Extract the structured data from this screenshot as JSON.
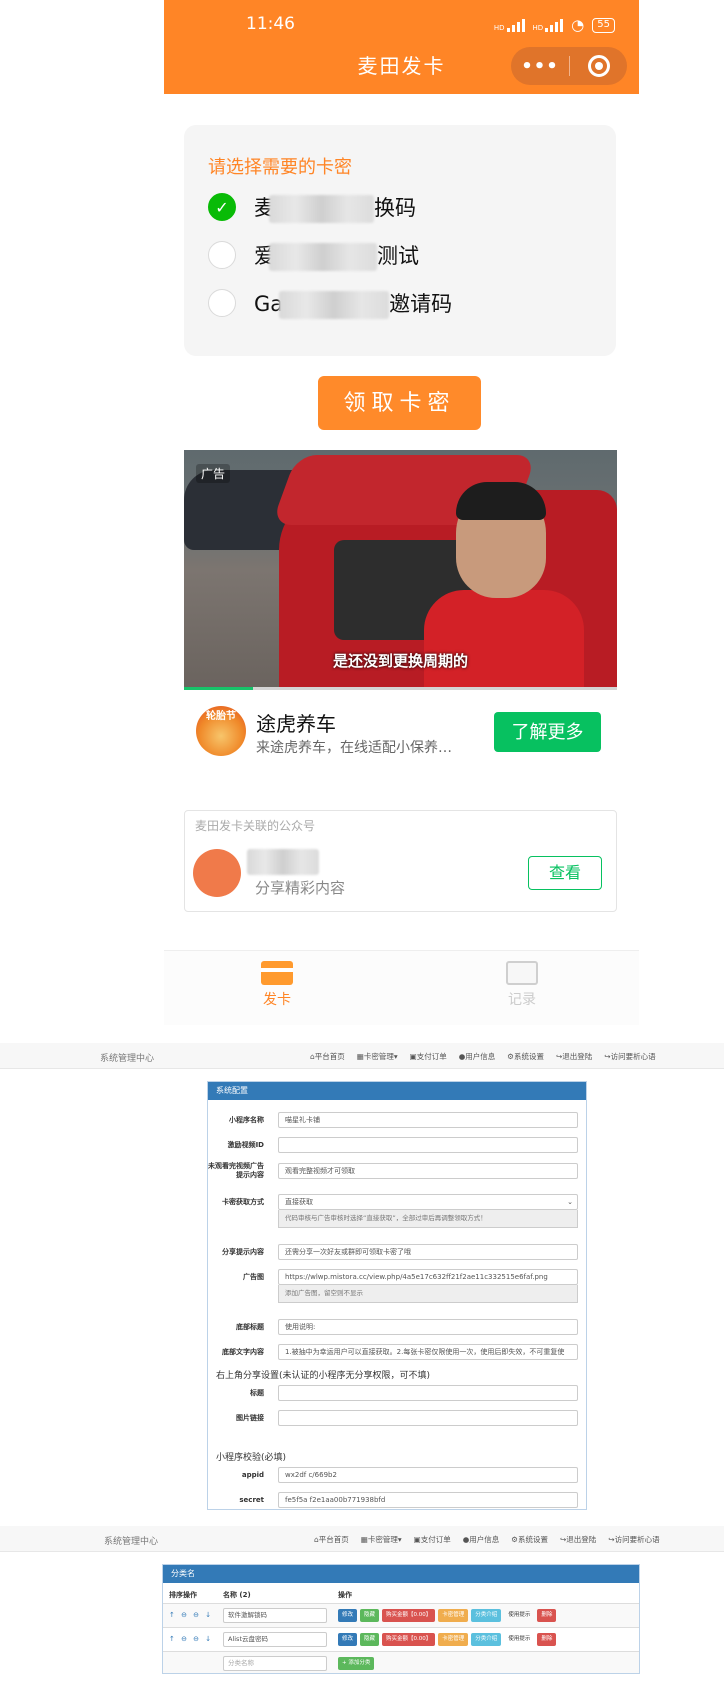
{
  "phone": {
    "status": {
      "time": "11:46",
      "battery": "55",
      "hd": "HD"
    },
    "app_title": "麦田发卡",
    "capsule": {
      "more": "•••"
    },
    "choose_title": "请选择需要的卡密",
    "options": [
      {
        "prefix": "麦",
        "suffix": "换码",
        "checked": true
      },
      {
        "prefix": "爱",
        "suffix": "测试",
        "checked": false
      },
      {
        "prefix": "Ga",
        "suffix": "邀请码",
        "checked": false
      }
    ],
    "get_button": "领取卡密",
    "ad": {
      "label": "广告",
      "subtitle": "是还没到更换周期的",
      "progress": 0.16,
      "logo_text": "轮胎节",
      "name": "途虎养车",
      "desc": "来途虎养车，在线适配小保养…",
      "more_button": "了解更多"
    },
    "official": {
      "title": "麦田发卡关联的公众号",
      "desc": "分享精彩内容",
      "view_button": "查看"
    },
    "tabs": [
      {
        "label": "发卡"
      },
      {
        "label": "记录"
      }
    ]
  },
  "admin_nav": {
    "brand": "系统管理中心",
    "menu": [
      "平台首页",
      "卡密管理",
      "支付订单",
      "用户信息",
      "系统设置",
      "退出登陆",
      "访问要析心语"
    ]
  },
  "config_panel": {
    "title": "系统配置",
    "fields": [
      {
        "label": "小程序名称",
        "value": "喵星礼卡铺"
      },
      {
        "label": "激励视频ID",
        "value": ""
      },
      {
        "label": "未观看完视频广告提示内容",
        "value": "观看完整视频才可领取"
      },
      {
        "label": "卡密获取方式",
        "value": "直接获取",
        "help": "代码审核与广告审核时选择“直接获取”，全部过审后再调整领取方式！"
      },
      {
        "label": "分享提示内容",
        "value": "还需分享一次好友或群即可领取卡密了哦"
      },
      {
        "label": "广告图",
        "value": "https://wlwp.mistora.cc/view.php/4a5e17c632ff21f2ae11c332515e6faf.png",
        "help": "添加广告图，留空则不显示"
      },
      {
        "label": "底部标题",
        "value": "使用说明:"
      },
      {
        "label": "底部文字内容",
        "value": "1.被抽中为幸运用户可以直接获取。2.每张卡密仅限使用一次，使用后即失效，不可重复使"
      }
    ],
    "share_section": "右上角分享设置(未认证的小程序无分享权限，可不填)",
    "share_fields": [
      {
        "label": "标题",
        "value": ""
      },
      {
        "label": "图片链接",
        "value": ""
      }
    ],
    "verify_section": "小程序校验(必填)",
    "verify_fields": [
      {
        "label": "appid",
        "value": "wx2df          c/669b2"
      },
      {
        "label": "secret",
        "value": "fe5f5a          f2e1aa00b771938bfd"
      }
    ]
  },
  "category_panel": {
    "title": "分类名",
    "headers": [
      "排序操作",
      "名称 (2)",
      "操作"
    ],
    "sort_icons": "↑ ⊖ ⊖ ↓",
    "rows": [
      {
        "name": "软件激解锁码"
      },
      {
        "name": "Alist云盘密码"
      }
    ],
    "row_buttons": [
      "修改",
      "隐藏",
      "购买金额【0.00】",
      "卡密管理",
      "分类介绍",
      "使用提示",
      "删除"
    ],
    "new_placeholder": "分类名称",
    "add_button": "+ 添加分类"
  }
}
